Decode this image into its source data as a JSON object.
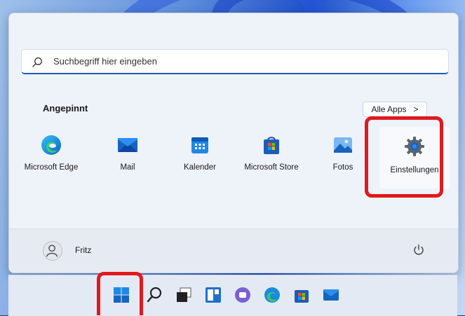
{
  "search": {
    "placeholder": "Suchbegriff hier eingeben"
  },
  "pinned": {
    "title": "Angepinnt",
    "all_apps_label": "Alle Apps",
    "all_apps_chevron": ">",
    "apps": [
      {
        "label": "Microsoft Edge",
        "icon": "edge-icon"
      },
      {
        "label": "Mail",
        "icon": "mail-icon"
      },
      {
        "label": "Kalender",
        "icon": "calendar-icon"
      },
      {
        "label": "Microsoft Store",
        "icon": "store-icon"
      },
      {
        "label": "Fotos",
        "icon": "photos-icon"
      },
      {
        "label": "Einstellungen",
        "icon": "gear-icon"
      }
    ]
  },
  "footer": {
    "user_name": "Fritz"
  },
  "taskbar": {
    "items": [
      "windows-start-icon",
      "search-icon",
      "task-view-icon",
      "widgets-icon",
      "chat-icon",
      "edge-icon",
      "store-icon",
      "mail-icon"
    ]
  },
  "colors": {
    "highlight_red": "#e0191e",
    "accent_blue": "#1a5fb4"
  }
}
